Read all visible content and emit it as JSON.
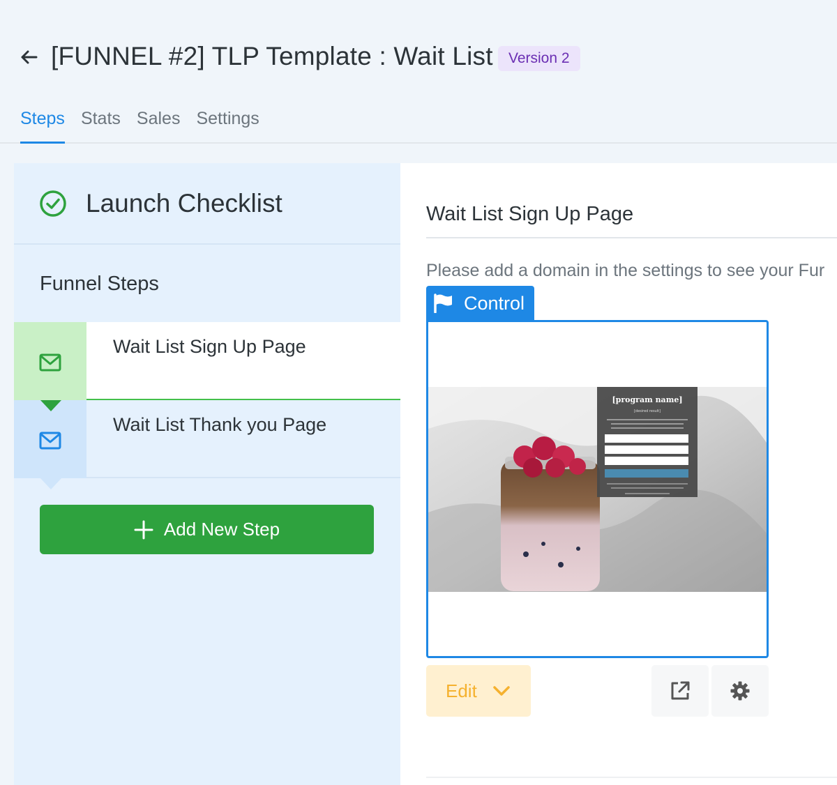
{
  "header": {
    "title": "[FUNNEL #2] TLP Template : Wait List",
    "version_badge": "Version 2"
  },
  "tabs": [
    {
      "label": "Steps",
      "active": true
    },
    {
      "label": "Stats",
      "active": false
    },
    {
      "label": "Sales",
      "active": false
    },
    {
      "label": "Settings",
      "active": false
    }
  ],
  "sidebar": {
    "checklist_label": "Launch Checklist",
    "funnel_steps_label": "Funnel Steps",
    "steps": [
      {
        "label": "Wait List Sign Up Page",
        "icon": "envelope-icon",
        "selected": true
      },
      {
        "label": "Wait List Thank you Page",
        "icon": "envelope-icon",
        "selected": false
      }
    ],
    "add_step_label": "Add New Step"
  },
  "main": {
    "page_title": "Wait List Sign Up Page",
    "notice": "Please add a domain in the settings to see your Fur",
    "control_label": "Control",
    "preview": {
      "program_name": "[program name]",
      "desired_result": "[desired result]"
    },
    "edit_label": "Edit"
  },
  "colors": {
    "accent_blue": "#1e88e5",
    "success_green": "#2ea23e",
    "version_purple": "#6b2fb3",
    "edit_orange": "#f5b12e"
  }
}
